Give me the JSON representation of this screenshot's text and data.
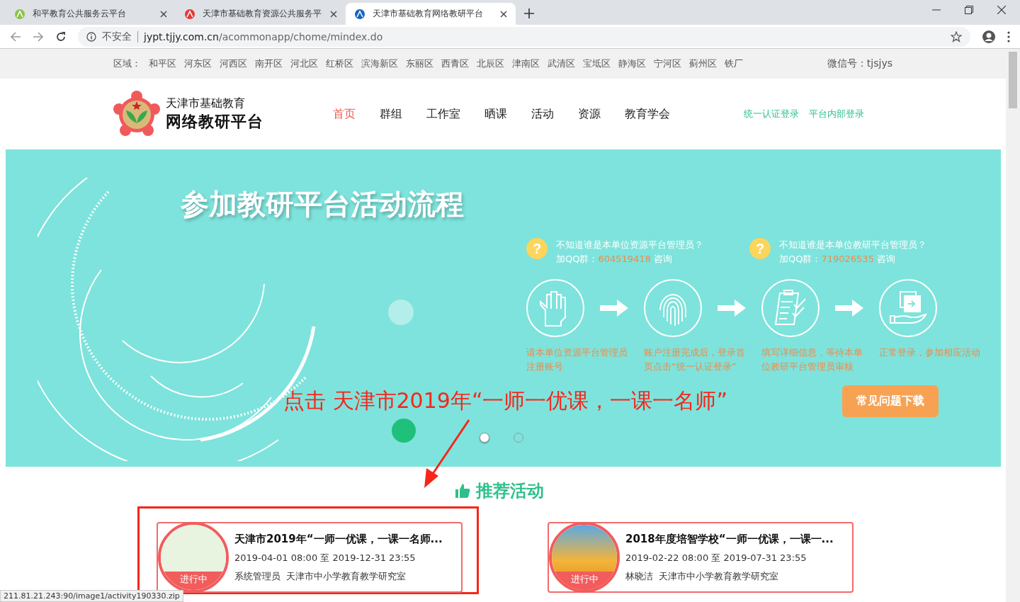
{
  "browser": {
    "tabs": [
      {
        "title": "和平教育公共服务云平台",
        "selected": false
      },
      {
        "title": "天津市基础教育资源公共服务平",
        "selected": false
      },
      {
        "title": "天津市基础教育网络教研平台",
        "selected": true
      }
    ],
    "security": "不安全",
    "url_host": "jypt.tjjy.com.cn",
    "url_path": "/acommonapp/chome/mindex.do"
  },
  "regions": {
    "label": "区域：",
    "items": [
      "和平区",
      "河东区",
      "河西区",
      "南开区",
      "河北区",
      "红桥区",
      "滨海新区",
      "东丽区",
      "西青区",
      "北辰区",
      "津南区",
      "武清区",
      "宝坻区",
      "静海区",
      "宁河区",
      "蓟州区",
      "铁厂"
    ],
    "wechat": "微信号：tjsjys"
  },
  "header": {
    "logo_line1": "天津市基础教育",
    "logo_line2": "网络教研平台",
    "nav": [
      {
        "label": "首页",
        "selected": true
      },
      {
        "label": "群组",
        "selected": false
      },
      {
        "label": "工作室",
        "selected": false
      },
      {
        "label": "晒课",
        "selected": false
      },
      {
        "label": "活动",
        "selected": false
      },
      {
        "label": "资源",
        "selected": false
      },
      {
        "label": "教育学会",
        "selected": false
      }
    ],
    "logins": [
      "统一认证登录",
      "平台内部登录"
    ]
  },
  "banner": {
    "title": "参加教研平台活动流程",
    "help": [
      {
        "icon": "?",
        "question": "不知道谁是本单位资源平台管理员？",
        "prefix": "加QQ群：",
        "number": "604519418",
        "suffix": "咨询"
      },
      {
        "icon": "?",
        "question": "不知道谁是本单位教研平台管理员？",
        "prefix": "加QQ群：",
        "number": "719026535",
        "suffix": "咨询"
      }
    ],
    "steps": [
      {
        "kind": "hand",
        "text": "请本单位资源平台管理员注册账号"
      },
      {
        "kind": "fingerprint",
        "text": "账户注册完成后，登录首页点击“统一认证登录”"
      },
      {
        "kind": "clipboard",
        "text": "填写详细信息，等待本单位教研平台管理员审核"
      },
      {
        "kind": "handover",
        "text": "正常登录，参加相应活动"
      }
    ],
    "button": "常见问题下载",
    "dots": [
      {
        "selected": true
      },
      {
        "selected": false
      }
    ]
  },
  "annotation": {
    "text": "点击 天津市2019年“一师一优课，一课一名师”"
  },
  "recommended": {
    "title": "推荐活动",
    "cards": [
      {
        "title": "天津市2019年“一师一优课，一课一名师...",
        "time": "2019-04-01 08:00 至 2019-12-31 23:55",
        "owner": "系统管理员",
        "org": "天津市中小学教育教学研究室",
        "status": "进行中",
        "highlighted": true
      },
      {
        "title": "2018年度培智学校“一师一优课，一课一...",
        "time": "2019-02-22 08:00 至 2019-07-31 23:55",
        "owner": "林晓洁",
        "org": "天津市中小学教育教学研究室",
        "status": "进行中",
        "highlighted": false
      }
    ]
  },
  "status_url": "211.81.21.243:90/image1/activity190330.zip"
}
